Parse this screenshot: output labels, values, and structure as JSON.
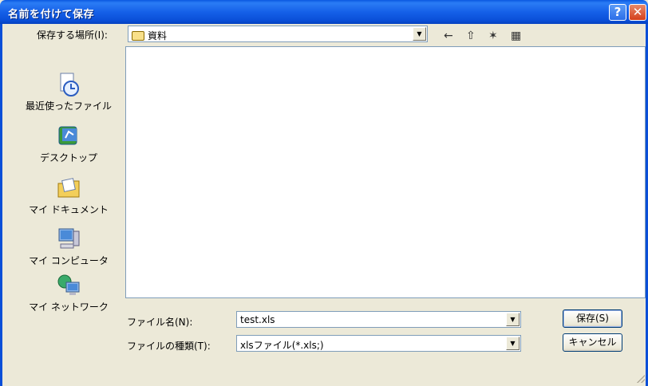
{
  "window": {
    "title": "名前を付けて保存",
    "help": "?",
    "close": "✕"
  },
  "save_in": {
    "label": "保存する場所(I):",
    "value": "資料"
  },
  "toolbar": {
    "back": "←",
    "up": "⇧",
    "new_folder": "✶",
    "views": "▦"
  },
  "places": [
    {
      "label": "最近使ったファイル",
      "icon": "recent-documents-icon"
    },
    {
      "label": "デスクトップ",
      "icon": "desktop-icon"
    },
    {
      "label": "マイ ドキュメント",
      "icon": "my-documents-icon"
    },
    {
      "label": "マイ コンピュータ",
      "icon": "my-computer-icon"
    },
    {
      "label": "マイ ネットワーク",
      "icon": "my-network-icon"
    }
  ],
  "filename": {
    "label": "ファイル名(N):",
    "value": "test.xls"
  },
  "filetype": {
    "label": "ファイルの種類(T):",
    "value": "xlsファイル(*.xls;)"
  },
  "buttons": {
    "save": "保存(S)",
    "cancel": "キャンセル"
  }
}
